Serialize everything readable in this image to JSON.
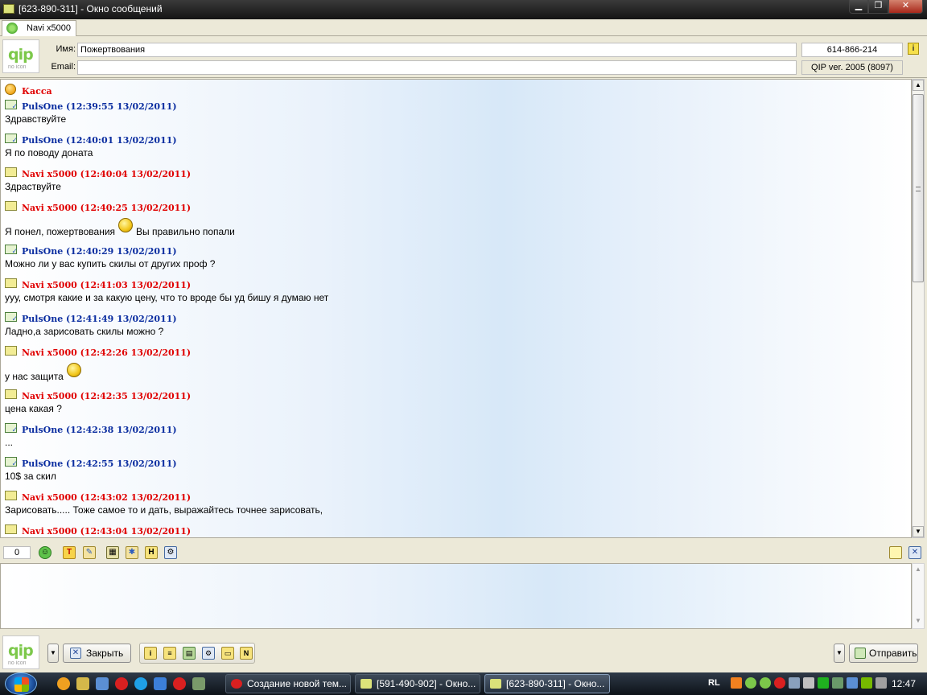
{
  "window": {
    "title": "[623-890-311] - Окно сообщений"
  },
  "tabs": [
    {
      "label": "Navi x5000"
    }
  ],
  "contact": {
    "name_label": "Имя:",
    "name_value": "Пожертвования",
    "email_label": "Email:",
    "email_value": "",
    "uin": "614-866-214",
    "client_version": "QIP ver. 2005 (8097)",
    "logo_text": "qip",
    "logo_sub": "no icon"
  },
  "log": {
    "system_sender": "Касса",
    "messages": [
      {
        "sender": "PulsOne (12:39:55 13/02/2011)",
        "text": "Здравствуйте",
        "dir": "in"
      },
      {
        "sender": "PulsOne (12:40:01 13/02/2011)",
        "text": "Я по поводу доната",
        "dir": "in"
      },
      {
        "sender": "Navi x5000 (12:40:04 13/02/2011)",
        "text": "Здраствуйте",
        "dir": "out"
      },
      {
        "sender": "Navi x5000 (12:40:25 13/02/2011)",
        "text": "Я понел, пожертвования",
        "text_after": "Вы правильно попали",
        "dir": "out",
        "smiley": true
      },
      {
        "sender": "PulsOne (12:40:29 13/02/2011)",
        "text": "Можно ли у вас купить скилы от других проф ?",
        "dir": "in"
      },
      {
        "sender": "Navi x5000 (12:41:03 13/02/2011)",
        "text": "ууу, смотря какие и за какую цену, что то вроде бы уд бишу я думаю нет",
        "dir": "out"
      },
      {
        "sender": "PulsOne (12:41:49 13/02/2011)",
        "text": "Ладно,а зарисовать скилы можно ?",
        "dir": "in"
      },
      {
        "sender": "Navi x5000 (12:42:26 13/02/2011)",
        "text": "у нас защита",
        "dir": "out",
        "smiley": true
      },
      {
        "sender": "Navi x5000 (12:42:35 13/02/2011)",
        "text": "цена какая ?",
        "dir": "out"
      },
      {
        "sender": "PulsOne (12:42:38 13/02/2011)",
        "text": "...",
        "dir": "in"
      },
      {
        "sender": "PulsOne (12:42:55 13/02/2011)",
        "text": "10$ за скил",
        "dir": "in"
      },
      {
        "sender": "Navi x5000 (12:43:02 13/02/2011)",
        "text": "Зарисовать..... Тоже самое то и дать, выражайтесь точнее зарисовать,",
        "dir": "out"
      },
      {
        "sender": "Navi x5000 (12:43:04 13/02/2011)",
        "text": "",
        "dir": "out"
      }
    ]
  },
  "input_toolbar": {
    "char_count": "0"
  },
  "input": {
    "value": ""
  },
  "buttons": {
    "close_label": "Закрыть",
    "send_label": "Отправить"
  },
  "taskbar": {
    "tasks": [
      {
        "label": "Создание новой тем..."
      },
      {
        "label": "[591-490-902] - Окно..."
      },
      {
        "label": "[623-890-311] - Окно..."
      }
    ],
    "language": "RL",
    "clock": "12:47"
  },
  "colors": {
    "outgoing_name": "#e00000",
    "incoming_name": "#0a2da0"
  }
}
